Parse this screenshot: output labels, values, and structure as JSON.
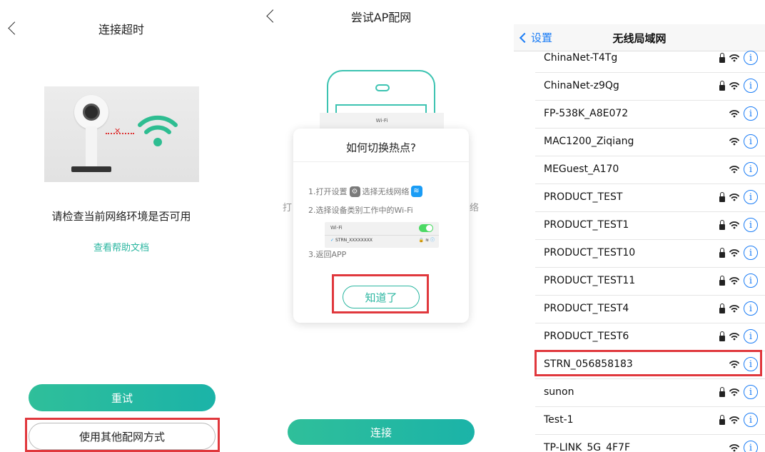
{
  "panel1": {
    "title": "连接超时",
    "check_text": "请检查当前网络环境是否可用",
    "help_link": "查看帮助文档",
    "retry_label": "重试",
    "other_method_label": "使用其他配网方式"
  },
  "panel2": {
    "title": "尝试AP配网",
    "phone_wifi_label": "Wi-Fi",
    "bg_text_left": "打",
    "bg_text_right": "络",
    "dialog": {
      "title": "如何切换热点?",
      "step1_a": "1.打开设置",
      "step1_b": "选择无线网络",
      "step2": "2.选择设备类别工作中的Wi-Fi",
      "step3": "3.返回APP",
      "mini_wifi_label": "Wi-Fi",
      "mini_ssid": "STRN_XXXXXXXX",
      "confirm_label": "知道了"
    },
    "connect_label": "连接"
  },
  "panel3": {
    "back_label": "设置",
    "title": "无线局域网",
    "networks": [
      {
        "name": "ChinaNet-T4Tg",
        "locked": true
      },
      {
        "name": "ChinaNet-z9Qg",
        "locked": true
      },
      {
        "name": "FP-538K_A8E072",
        "locked": false
      },
      {
        "name": "MAC1200_Ziqiang",
        "locked": false
      },
      {
        "name": "MEGuest_A170",
        "locked": false
      },
      {
        "name": "PRODUCT_TEST",
        "locked": true
      },
      {
        "name": "PRODUCT_TEST1",
        "locked": true
      },
      {
        "name": "PRODUCT_TEST10",
        "locked": true
      },
      {
        "name": "PRODUCT_TEST11",
        "locked": true
      },
      {
        "name": "PRODUCT_TEST4",
        "locked": true
      },
      {
        "name": "PRODUCT_TEST6",
        "locked": true
      },
      {
        "name": "STRN_056858183",
        "locked": false,
        "highlighted": true
      },
      {
        "name": "sunon",
        "locked": true
      },
      {
        "name": "Test-1",
        "locked": true
      },
      {
        "name": "TP-LINK_5G_4F7F",
        "locked": false
      }
    ]
  },
  "colors": {
    "accent_teal": "#2ab6a0",
    "ios_blue": "#1a7cf5",
    "highlight_red": "#e0383d"
  }
}
